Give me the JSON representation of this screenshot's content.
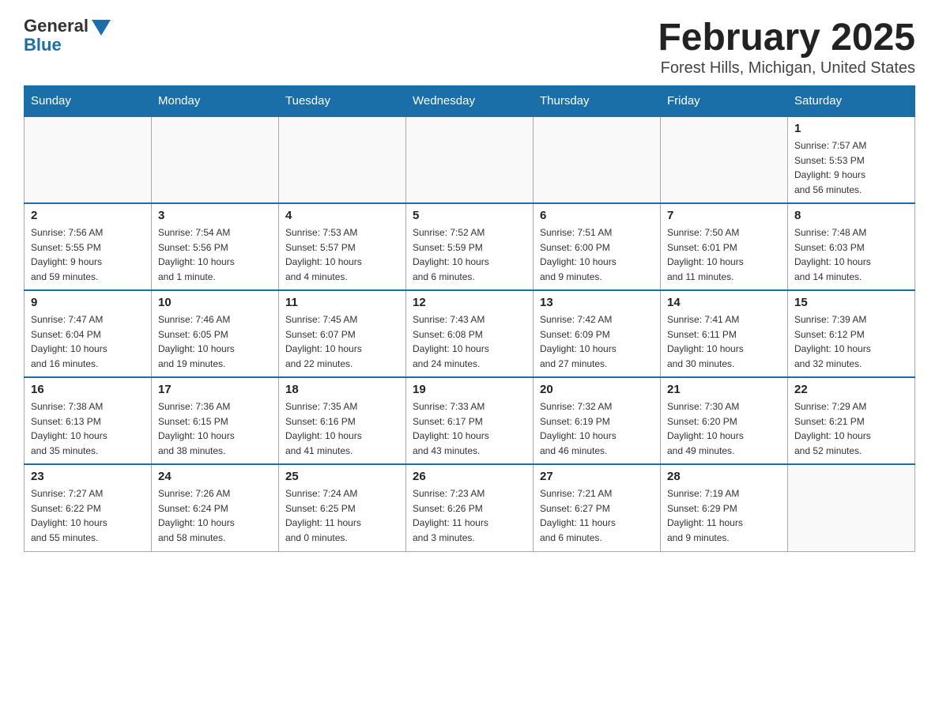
{
  "header": {
    "logo_general": "General",
    "logo_blue": "Blue",
    "title": "February 2025",
    "subtitle": "Forest Hills, Michigan, United States"
  },
  "days_of_week": [
    "Sunday",
    "Monday",
    "Tuesday",
    "Wednesday",
    "Thursday",
    "Friday",
    "Saturday"
  ],
  "weeks": [
    [
      {
        "day": "",
        "info": ""
      },
      {
        "day": "",
        "info": ""
      },
      {
        "day": "",
        "info": ""
      },
      {
        "day": "",
        "info": ""
      },
      {
        "day": "",
        "info": ""
      },
      {
        "day": "",
        "info": ""
      },
      {
        "day": "1",
        "info": "Sunrise: 7:57 AM\nSunset: 5:53 PM\nDaylight: 9 hours\nand 56 minutes."
      }
    ],
    [
      {
        "day": "2",
        "info": "Sunrise: 7:56 AM\nSunset: 5:55 PM\nDaylight: 9 hours\nand 59 minutes."
      },
      {
        "day": "3",
        "info": "Sunrise: 7:54 AM\nSunset: 5:56 PM\nDaylight: 10 hours\nand 1 minute."
      },
      {
        "day": "4",
        "info": "Sunrise: 7:53 AM\nSunset: 5:57 PM\nDaylight: 10 hours\nand 4 minutes."
      },
      {
        "day": "5",
        "info": "Sunrise: 7:52 AM\nSunset: 5:59 PM\nDaylight: 10 hours\nand 6 minutes."
      },
      {
        "day": "6",
        "info": "Sunrise: 7:51 AM\nSunset: 6:00 PM\nDaylight: 10 hours\nand 9 minutes."
      },
      {
        "day": "7",
        "info": "Sunrise: 7:50 AM\nSunset: 6:01 PM\nDaylight: 10 hours\nand 11 minutes."
      },
      {
        "day": "8",
        "info": "Sunrise: 7:48 AM\nSunset: 6:03 PM\nDaylight: 10 hours\nand 14 minutes."
      }
    ],
    [
      {
        "day": "9",
        "info": "Sunrise: 7:47 AM\nSunset: 6:04 PM\nDaylight: 10 hours\nand 16 minutes."
      },
      {
        "day": "10",
        "info": "Sunrise: 7:46 AM\nSunset: 6:05 PM\nDaylight: 10 hours\nand 19 minutes."
      },
      {
        "day": "11",
        "info": "Sunrise: 7:45 AM\nSunset: 6:07 PM\nDaylight: 10 hours\nand 22 minutes."
      },
      {
        "day": "12",
        "info": "Sunrise: 7:43 AM\nSunset: 6:08 PM\nDaylight: 10 hours\nand 24 minutes."
      },
      {
        "day": "13",
        "info": "Sunrise: 7:42 AM\nSunset: 6:09 PM\nDaylight: 10 hours\nand 27 minutes."
      },
      {
        "day": "14",
        "info": "Sunrise: 7:41 AM\nSunset: 6:11 PM\nDaylight: 10 hours\nand 30 minutes."
      },
      {
        "day": "15",
        "info": "Sunrise: 7:39 AM\nSunset: 6:12 PM\nDaylight: 10 hours\nand 32 minutes."
      }
    ],
    [
      {
        "day": "16",
        "info": "Sunrise: 7:38 AM\nSunset: 6:13 PM\nDaylight: 10 hours\nand 35 minutes."
      },
      {
        "day": "17",
        "info": "Sunrise: 7:36 AM\nSunset: 6:15 PM\nDaylight: 10 hours\nand 38 minutes."
      },
      {
        "day": "18",
        "info": "Sunrise: 7:35 AM\nSunset: 6:16 PM\nDaylight: 10 hours\nand 41 minutes."
      },
      {
        "day": "19",
        "info": "Sunrise: 7:33 AM\nSunset: 6:17 PM\nDaylight: 10 hours\nand 43 minutes."
      },
      {
        "day": "20",
        "info": "Sunrise: 7:32 AM\nSunset: 6:19 PM\nDaylight: 10 hours\nand 46 minutes."
      },
      {
        "day": "21",
        "info": "Sunrise: 7:30 AM\nSunset: 6:20 PM\nDaylight: 10 hours\nand 49 minutes."
      },
      {
        "day": "22",
        "info": "Sunrise: 7:29 AM\nSunset: 6:21 PM\nDaylight: 10 hours\nand 52 minutes."
      }
    ],
    [
      {
        "day": "23",
        "info": "Sunrise: 7:27 AM\nSunset: 6:22 PM\nDaylight: 10 hours\nand 55 minutes."
      },
      {
        "day": "24",
        "info": "Sunrise: 7:26 AM\nSunset: 6:24 PM\nDaylight: 10 hours\nand 58 minutes."
      },
      {
        "day": "25",
        "info": "Sunrise: 7:24 AM\nSunset: 6:25 PM\nDaylight: 11 hours\nand 0 minutes."
      },
      {
        "day": "26",
        "info": "Sunrise: 7:23 AM\nSunset: 6:26 PM\nDaylight: 11 hours\nand 3 minutes."
      },
      {
        "day": "27",
        "info": "Sunrise: 7:21 AM\nSunset: 6:27 PM\nDaylight: 11 hours\nand 6 minutes."
      },
      {
        "day": "28",
        "info": "Sunrise: 7:19 AM\nSunset: 6:29 PM\nDaylight: 11 hours\nand 9 minutes."
      },
      {
        "day": "",
        "info": ""
      }
    ]
  ]
}
